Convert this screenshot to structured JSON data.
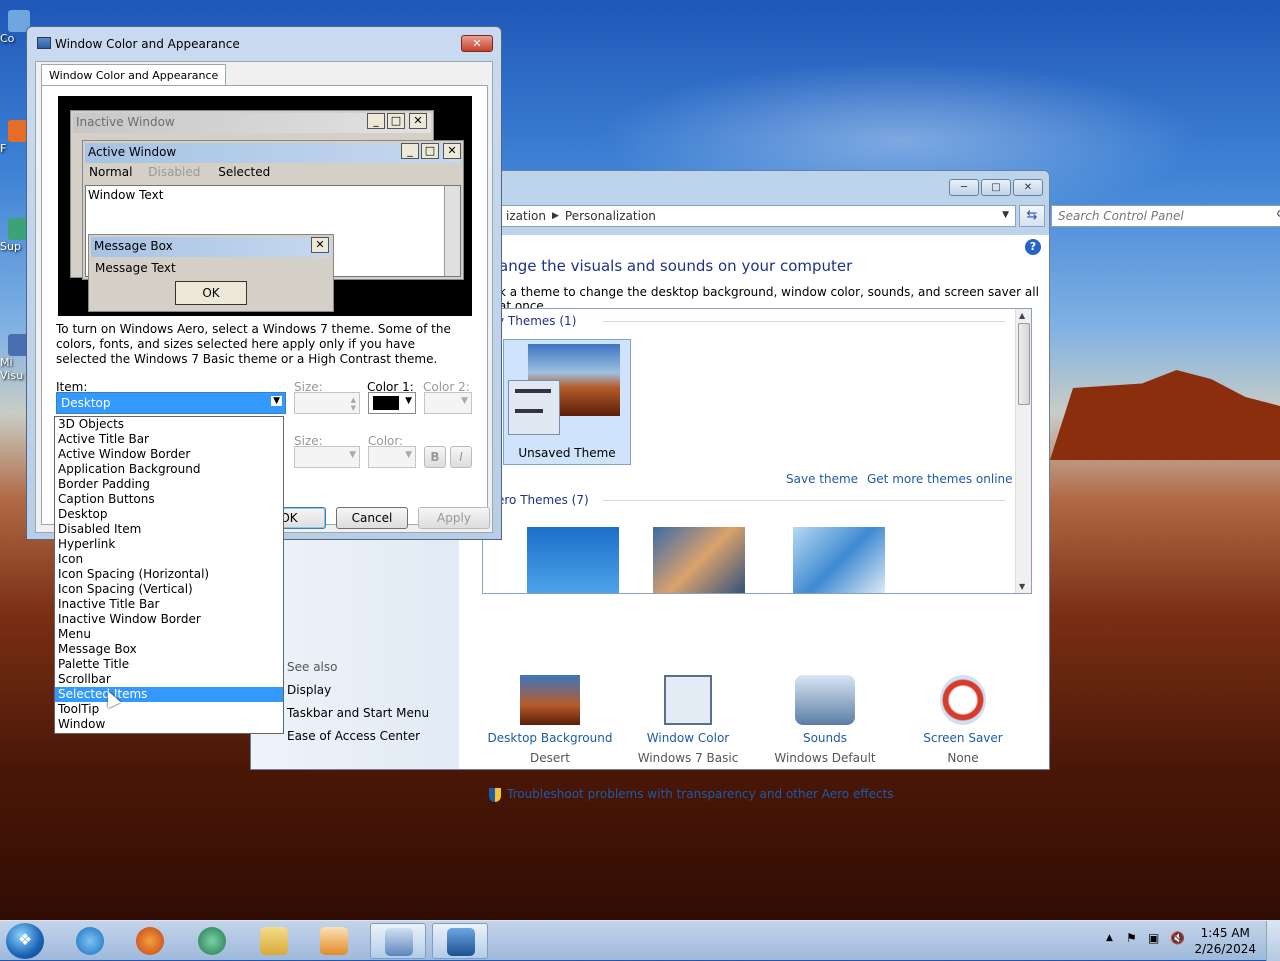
{
  "desktop": {
    "icons": [
      "Co",
      "F",
      "Sup",
      "Mi Visu"
    ]
  },
  "control_panel": {
    "breadcrumb": [
      "ization",
      "Personalization"
    ],
    "search_placeholder": "Search Control Panel",
    "heading": "ange the visuals and sounds on your computer",
    "subheading": "k a theme to change the desktop background, window color, sounds, and screen saver all at once.",
    "my_themes": "y Themes (1)",
    "unsaved_theme": "Unsaved Theme",
    "save_theme": "Save theme",
    "get_more": "Get more themes online",
    "aero_themes": "ero Themes (7)",
    "bottom": [
      {
        "title": "Desktop Background",
        "value": "Desert"
      },
      {
        "title": "Window Color",
        "value": "Windows 7 Basic"
      },
      {
        "title": "Sounds",
        "value": "Windows Default"
      },
      {
        "title": "Screen Saver",
        "value": "None"
      }
    ],
    "troubleshoot": "Troubleshoot problems with transparency and other Aero effects",
    "see_also": {
      "title": "See also",
      "links": [
        "Display",
        "Taskbar and Start Menu",
        "Ease of Access Center"
      ]
    }
  },
  "dialog": {
    "title": "Window Color and Appearance",
    "tab": "Window Color and Appearance",
    "preview": {
      "inactive_title": "Inactive Window",
      "active_title": "Active Window",
      "menu_normal": "Normal",
      "menu_disabled": "Disabled",
      "menu_selected": "Selected",
      "window_text": "Window Text",
      "msgbox_title": "Message Box",
      "msgbox_text": "Message Text",
      "msgbox_ok": "OK"
    },
    "info": "To turn on Windows Aero, select a Windows 7 theme.  Some of the colors, fonts, and sizes selected here apply only if you have selected the Windows 7 Basic theme or a High Contrast theme.",
    "item_label": "Item:",
    "size_label": "Size:",
    "color1_label": "Color 1:",
    "color2_label": "Color 2:",
    "font_size_label": "Size:",
    "font_color_label": "Color:",
    "item_value": "Desktop",
    "bold": "B",
    "italic": "I",
    "ok": "OK",
    "cancel": "Cancel",
    "apply": "Apply",
    "color1_value": "#000000",
    "items": [
      "3D Objects",
      "Active Title Bar",
      "Active Window Border",
      "Application Background",
      "Border Padding",
      "Caption Buttons",
      "Desktop",
      "Disabled Item",
      "Hyperlink",
      "Icon",
      "Icon Spacing (Horizontal)",
      "Icon Spacing (Vertical)",
      "Inactive Title Bar",
      "Inactive Window Border",
      "Menu",
      "Message Box",
      "Palette Title",
      "Scrollbar",
      "Selected Items",
      "ToolTip",
      "Window"
    ],
    "selected_index": 18
  },
  "taskbar": {
    "time": "1:45 AM",
    "date": "2/26/2024"
  }
}
